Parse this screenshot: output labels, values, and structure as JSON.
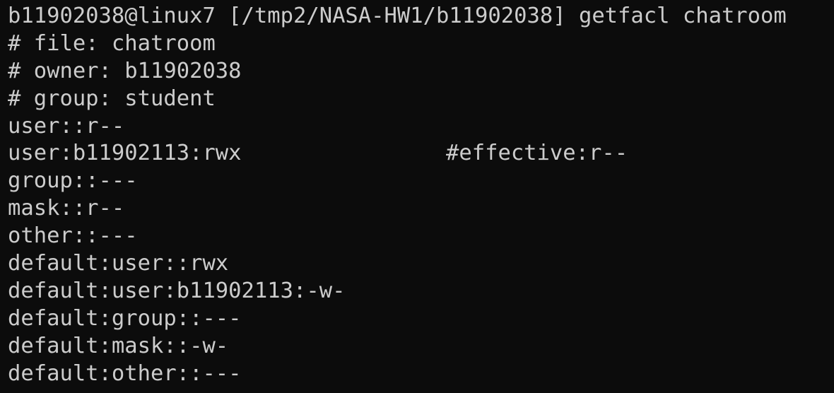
{
  "terminal": {
    "prompt": "b11902038@linux7 [/tmp2/NASA-HW1/b11902038] ",
    "command": "getfacl chatroom",
    "header": [
      "# file: chatroom",
      "# owner: b11902038",
      "# group: student"
    ],
    "entries": [
      "user::r--",
      "user:b11902113:rwx",
      "group::---",
      "mask::r--",
      "other::---",
      "default:user::rwx",
      "default:user:b11902113:-w-",
      "default:group::---",
      "default:mask::-w-",
      "default:other::---"
    ],
    "effective_note": "#effective:r--",
    "colors": {
      "background": "#0c0c0c",
      "foreground": "#cccccc"
    }
  }
}
